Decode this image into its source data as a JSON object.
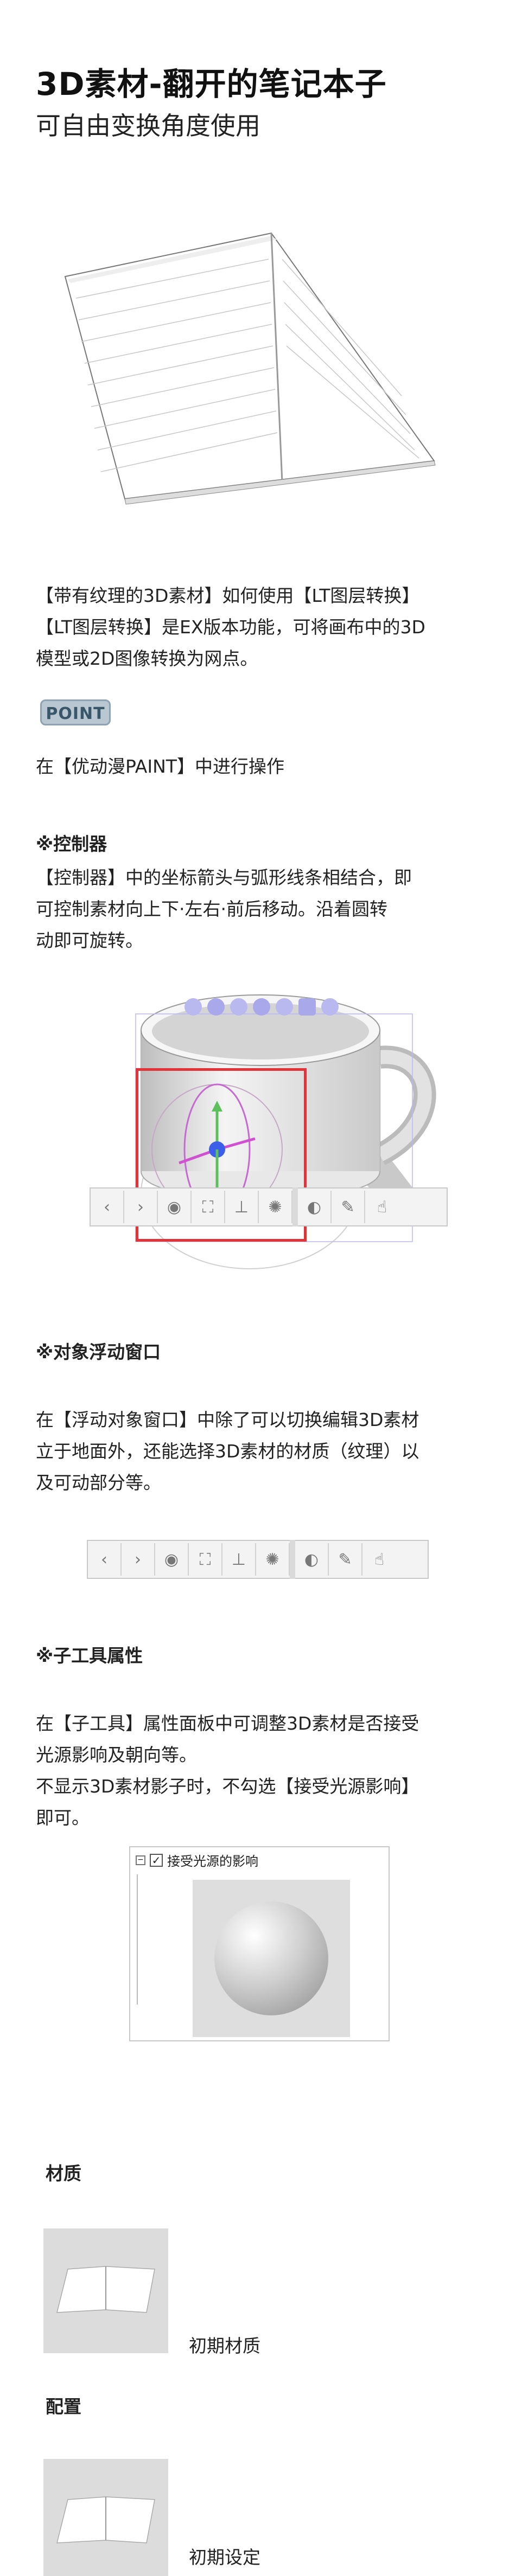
{
  "header": {
    "title": "3D素材-翻开的笔记本子",
    "subtitle": "可自由变换角度使用"
  },
  "intro": {
    "line1": "【带有纹理的3D素材】如何使用【LT图层转换】",
    "line2": "【LT图层转换】是EX版本功能，可将画布中的3D",
    "line3": "模型或2D图像转换为网点。"
  },
  "point_badge": "POINT",
  "point_text": "在【优动漫PAINT】中进行操作",
  "controller": {
    "heading": "※控制器",
    "line1": "【控制器】中的坐标箭头与弧形线条相结合，即",
    "line2": "可控制素材向上下·左右·前后移动。沿着圆转",
    "line3": "动即可旋转。"
  },
  "floating": {
    "heading": "※对象浮动窗口",
    "line1": "在【浮动对象窗口】中除了可以切换编辑3D素材",
    "line2": "立于地面外，还能选择3D素材的材质（纹理）以",
    "line3": "及可动部分等。"
  },
  "subtool": {
    "heading": "※子工具属性",
    "line1": "在【子工具】属性面板中可调整3D素材是否接受",
    "line2": "光源影响及朝向等。",
    "line3": "不显示3D素材影子时，不勾选【接受光源影响】",
    "line4": "即可。",
    "checkbox_label": "接受光源的影响"
  },
  "toolbar": {
    "prev": "‹",
    "next": "›"
  },
  "materials": {
    "heading": "材质",
    "item_label": "初期材质"
  },
  "layout_section": {
    "heading": "配置",
    "item_label": "初期设定"
  },
  "colors": {
    "accent_red": "#e0343a",
    "badge_bg": "#b9c7d2",
    "toolbar_bg": "#f3f3f3"
  }
}
